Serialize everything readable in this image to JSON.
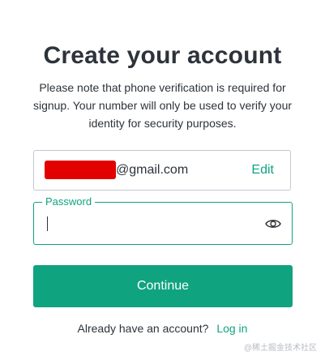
{
  "header": {
    "title": "Create your account",
    "subtitle": "Please note that phone verification is required for signup. Your number will only be used to verify your identity for security purposes."
  },
  "email": {
    "domain_text": "@gmail.com",
    "edit_label": "Edit",
    "redaction_color": "#e30000"
  },
  "password": {
    "label": "Password",
    "value": "",
    "toggle_icon": "eye-icon"
  },
  "actions": {
    "continue_label": "Continue"
  },
  "footer": {
    "prompt": "Already have an account?",
    "login_label": "Log in"
  },
  "watermark": {
    "text": "@稀土掘金技术社区"
  },
  "colors": {
    "accent": "#10a37f",
    "text": "#2d333a",
    "border": "#c2c8d0"
  }
}
